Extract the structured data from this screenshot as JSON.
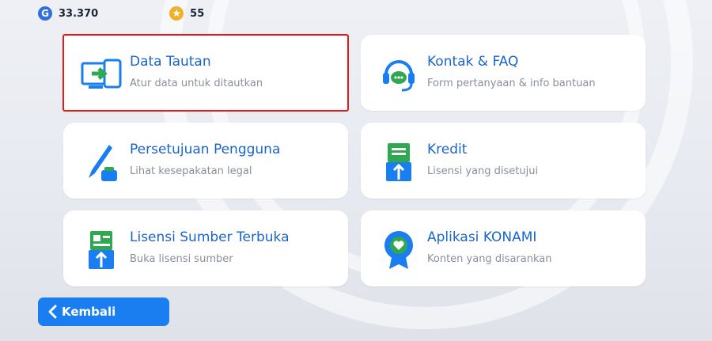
{
  "currencies": [
    {
      "icon": "g-coin-icon",
      "symbol": "G",
      "value": "33.370"
    },
    {
      "icon": "star-coin-icon",
      "symbol": "★",
      "value": "55"
    }
  ],
  "cards": [
    {
      "title": "Data Tautan",
      "subtitle": "Atur data untuk ditautkan",
      "icon": "link-device-icon",
      "selected": true
    },
    {
      "title": "Kontak & FAQ",
      "subtitle": "Form pertanyaan & info bantuan",
      "icon": "headset-chat-icon",
      "selected": false
    },
    {
      "title": "Persetujuan Pengguna",
      "subtitle": "Lihat kesepakatan legal",
      "icon": "pen-ink-icon",
      "selected": false
    },
    {
      "title": "Kredit",
      "subtitle": "Lisensi yang disetujui",
      "icon": "credits-book-icon",
      "selected": false
    },
    {
      "title": "Lisensi Sumber Terbuka",
      "subtitle": "Buka lisensi sumber",
      "icon": "license-book-icon",
      "selected": false
    },
    {
      "title": "Aplikasi KONAMI",
      "subtitle": "Konten yang disarankan",
      "icon": "konami-badge-icon",
      "selected": false
    }
  ],
  "back_button": {
    "label": "Kembali",
    "icon": "chevron-left-icon"
  },
  "colors": {
    "accent": "#1a65c9",
    "icon_green": "#2fa84f",
    "selection": "#e21b1b",
    "button": "#1a7ef0"
  }
}
